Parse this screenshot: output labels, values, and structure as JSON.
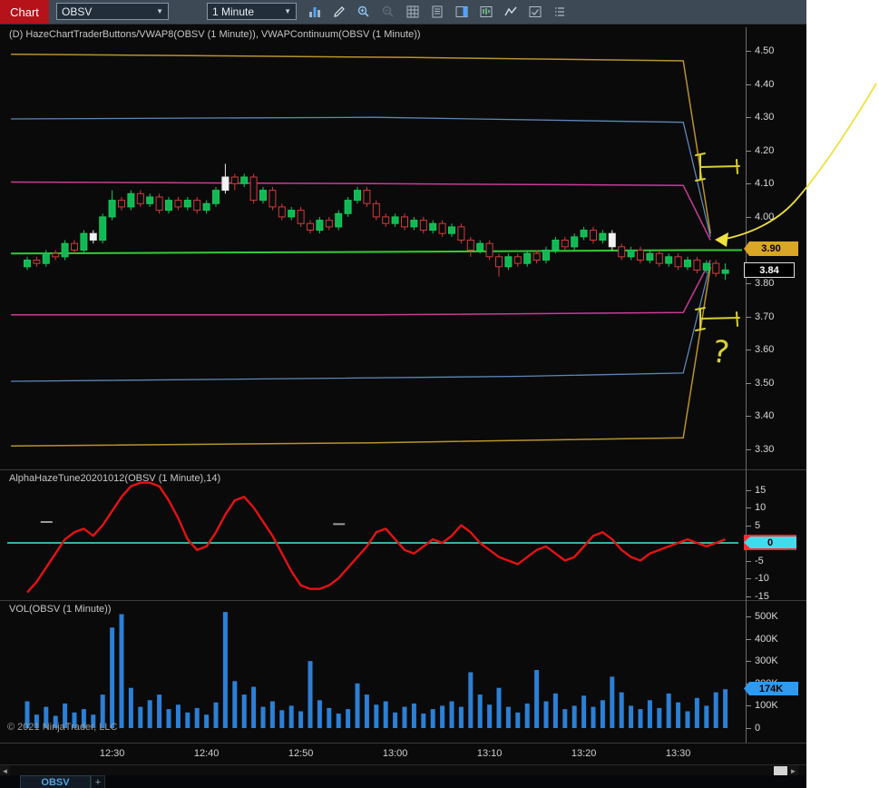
{
  "toolbar": {
    "chart_label": "Chart",
    "symbol": "OBSV",
    "interval": "1 Minute",
    "icons": [
      "chart-style",
      "drawing-tools",
      "zoom-in",
      "zoom-out",
      "grid",
      "report",
      "chart-trader",
      "data-box",
      "indicators",
      "strategies",
      "properties"
    ]
  },
  "panels": {
    "price": {
      "title": "(D) HazeChartTraderButtons/VWAP8(OBSV (1 Minute)), VWAPContinuum(OBSV (1 Minute))"
    },
    "oscillator": {
      "title": "AlphaHazeTune20201012(OBSV (1 Minute),14)"
    },
    "volume": {
      "title": "VOL(OBSV (1 Minute))"
    }
  },
  "copyright": "© 2021 NinjaTrader, LLC",
  "tabs": {
    "active": "OBSV",
    "add_label": "+"
  },
  "annotations": {
    "question_mark": "?"
  },
  "scrollbar": {
    "left_arrow": "◄",
    "right_arrow": "►"
  },
  "chart_data": [
    {
      "type": "candlestick",
      "panel": "price",
      "symbol": "OBSV",
      "interval": "1 Minute",
      "ylim": [
        3.28,
        4.52
      ],
      "y_ticks": [
        "4.50",
        "4.40",
        "4.30",
        "4.20",
        "4.10",
        "4.00",
        "3.90",
        "3.80",
        "3.70",
        "3.60",
        "3.50",
        "3.40",
        "3.30"
      ],
      "x_ticks": [
        "12:30",
        "12:40",
        "12:50",
        "13:00",
        "13:10",
        "13:20",
        "13:30"
      ],
      "price_markers": [
        {
          "label": "3.90",
          "color": "#d9a625"
        },
        {
          "label": "3.84",
          "color": "#000000"
        }
      ],
      "overlays": [
        {
          "name": "vwap-upper-3",
          "color": "#b8922c",
          "width": 1.5,
          "points": [
            [
              0.005,
              4.49
            ],
            [
              0.55,
              4.48
            ],
            [
              0.92,
              4.47
            ],
            [
              0.957,
              3.95
            ]
          ]
        },
        {
          "name": "vwap-upper-2",
          "color": "#5d87b8",
          "width": 1.3,
          "points": [
            [
              0.005,
              4.295
            ],
            [
              0.5,
              4.3
            ],
            [
              0.92,
              4.285
            ],
            [
              0.957,
              3.94
            ]
          ]
        },
        {
          "name": "vwap-upper-1",
          "color": "#c93c96",
          "width": 1.5,
          "points": [
            [
              0.005,
              4.105
            ],
            [
              0.5,
              4.1
            ],
            [
              0.92,
              4.095
            ],
            [
              0.957,
              3.93
            ]
          ]
        },
        {
          "name": "vwap",
          "color": "#33cc33",
          "width": 2.0,
          "points": [
            [
              0.005,
              3.89
            ],
            [
              0.55,
              3.895
            ],
            [
              0.93,
              3.9
            ],
            [
              1.0,
              3.9
            ]
          ]
        },
        {
          "name": "vwap-lower-1",
          "color": "#c93c96",
          "width": 1.5,
          "points": [
            [
              0.005,
              3.705
            ],
            [
              0.5,
              3.705
            ],
            [
              0.92,
              3.712
            ],
            [
              0.957,
              3.87
            ]
          ]
        },
        {
          "name": "vwap-lower-2",
          "color": "#5d87b8",
          "width": 1.3,
          "points": [
            [
              0.005,
              3.505
            ],
            [
              0.35,
              3.512
            ],
            [
              0.7,
              3.52
            ],
            [
              0.92,
              3.53
            ],
            [
              0.957,
              3.86
            ]
          ]
        },
        {
          "name": "vwap-lower-3",
          "color": "#b8922c",
          "width": 1.5,
          "points": [
            [
              0.005,
              3.31
            ],
            [
              0.5,
              3.32
            ],
            [
              0.92,
              3.335
            ],
            [
              0.957,
              3.85
            ]
          ]
        }
      ],
      "white_candles": [
        7,
        21,
        62
      ],
      "candles": [
        [
          3.85,
          3.88,
          3.84,
          3.87
        ],
        [
          3.87,
          3.88,
          3.85,
          3.86
        ],
        [
          3.86,
          3.9,
          3.85,
          3.89
        ],
        [
          3.89,
          3.9,
          3.87,
          3.88
        ],
        [
          3.88,
          3.93,
          3.87,
          3.92
        ],
        [
          3.92,
          3.93,
          3.89,
          3.9
        ],
        [
          3.9,
          3.96,
          3.89,
          3.95
        ],
        [
          3.95,
          3.96,
          3.92,
          3.93
        ],
        [
          3.93,
          4.01,
          3.92,
          4.0
        ],
        [
          4.0,
          4.08,
          3.99,
          4.05
        ],
        [
          4.05,
          4.06,
          4.02,
          4.03
        ],
        [
          4.03,
          4.08,
          4.02,
          4.07
        ],
        [
          4.07,
          4.08,
          4.03,
          4.04
        ],
        [
          4.04,
          4.07,
          4.03,
          4.06
        ],
        [
          4.06,
          4.07,
          4.01,
          4.02
        ],
        [
          4.02,
          4.06,
          4.01,
          4.05
        ],
        [
          4.05,
          4.06,
          4.02,
          4.03
        ],
        [
          4.03,
          4.06,
          4.02,
          4.05
        ],
        [
          4.05,
          4.06,
          4.01,
          4.02
        ],
        [
          4.02,
          4.05,
          4.01,
          4.04
        ],
        [
          4.04,
          4.09,
          4.03,
          4.08
        ],
        [
          4.08,
          4.16,
          4.07,
          4.12
        ],
        [
          4.12,
          4.13,
          4.08,
          4.1
        ],
        [
          4.1,
          4.13,
          4.09,
          4.12
        ],
        [
          4.12,
          4.13,
          4.04,
          4.05
        ],
        [
          4.05,
          4.09,
          4.04,
          4.08
        ],
        [
          4.08,
          4.09,
          4.02,
          4.03
        ],
        [
          4.03,
          4.04,
          3.99,
          4.0
        ],
        [
          4.0,
          4.03,
          3.99,
          4.02
        ],
        [
          4.02,
          4.03,
          3.97,
          3.98
        ],
        [
          3.98,
          3.99,
          3.95,
          3.96
        ],
        [
          3.96,
          4.0,
          3.95,
          3.99
        ],
        [
          3.99,
          4.0,
          3.96,
          3.97
        ],
        [
          3.97,
          4.02,
          3.96,
          4.01
        ],
        [
          4.01,
          4.06,
          4.0,
          4.05
        ],
        [
          4.05,
          4.09,
          4.04,
          4.08
        ],
        [
          4.08,
          4.09,
          4.03,
          4.04
        ],
        [
          4.04,
          4.05,
          3.99,
          4.0
        ],
        [
          4.0,
          4.01,
          3.97,
          3.98
        ],
        [
          3.98,
          4.01,
          3.97,
          4.0
        ],
        [
          4.0,
          4.01,
          3.96,
          3.97
        ],
        [
          3.97,
          4.0,
          3.96,
          3.99
        ],
        [
          3.99,
          4.0,
          3.95,
          3.96
        ],
        [
          3.96,
          3.99,
          3.95,
          3.98
        ],
        [
          3.98,
          3.99,
          3.94,
          3.95
        ],
        [
          3.95,
          3.98,
          3.94,
          3.97
        ],
        [
          3.97,
          3.98,
          3.92,
          3.93
        ],
        [
          3.93,
          3.94,
          3.88,
          3.9
        ],
        [
          3.9,
          3.93,
          3.89,
          3.92
        ],
        [
          3.92,
          3.93,
          3.87,
          3.88
        ],
        [
          3.88,
          3.89,
          3.82,
          3.85
        ],
        [
          3.85,
          3.89,
          3.84,
          3.88
        ],
        [
          3.88,
          3.89,
          3.85,
          3.86
        ],
        [
          3.86,
          3.9,
          3.85,
          3.89
        ],
        [
          3.89,
          3.9,
          3.86,
          3.87
        ],
        [
          3.87,
          3.91,
          3.86,
          3.9
        ],
        [
          3.9,
          3.94,
          3.89,
          3.93
        ],
        [
          3.93,
          3.94,
          3.9,
          3.91
        ],
        [
          3.91,
          3.95,
          3.9,
          3.94
        ],
        [
          3.94,
          3.97,
          3.93,
          3.96
        ],
        [
          3.96,
          3.97,
          3.92,
          3.93
        ],
        [
          3.93,
          3.96,
          3.92,
          3.95
        ],
        [
          3.95,
          3.96,
          3.9,
          3.91
        ],
        [
          3.91,
          3.92,
          3.87,
          3.88
        ],
        [
          3.88,
          3.91,
          3.87,
          3.9
        ],
        [
          3.9,
          3.91,
          3.86,
          3.87
        ],
        [
          3.87,
          3.9,
          3.86,
          3.89
        ],
        [
          3.89,
          3.9,
          3.85,
          3.86
        ],
        [
          3.86,
          3.89,
          3.85,
          3.88
        ],
        [
          3.88,
          3.89,
          3.84,
          3.85
        ],
        [
          3.85,
          3.88,
          3.84,
          3.87
        ],
        [
          3.87,
          3.88,
          3.83,
          3.84
        ],
        [
          3.84,
          3.87,
          3.83,
          3.86
        ],
        [
          3.86,
          3.87,
          3.82,
          3.83
        ],
        [
          3.83,
          3.86,
          3.81,
          3.84
        ]
      ]
    },
    {
      "type": "line",
      "panel": "oscillator",
      "name": "AlphaHazeTune20201012",
      "ylim": [
        -17,
        17
      ],
      "y_ticks": [
        "15",
        "10",
        "5",
        "0",
        "-5",
        "-10",
        "-15"
      ],
      "zero_line": 0,
      "marker": {
        "label": "0"
      },
      "dash_markers": [
        {
          "bar": 2,
          "value": 5.9
        },
        {
          "bar": 33,
          "value": 5.3
        }
      ],
      "values": [
        -14,
        -11,
        -7,
        -3,
        1,
        3,
        4,
        2,
        5,
        9,
        13,
        16,
        17,
        17,
        16,
        12,
        7,
        1,
        -2,
        -1,
        3,
        8,
        12,
        13,
        10,
        6,
        2,
        -3,
        -8,
        -12,
        -13,
        -13,
        -12,
        -10,
        -7,
        -4,
        -1,
        3,
        4,
        1,
        -2,
        -3,
        -1,
        1,
        0,
        2,
        5,
        3,
        0,
        -2,
        -4,
        -5,
        -6,
        -4,
        -2,
        -1,
        -3,
        -5,
        -4,
        -1,
        2,
        3,
        1,
        -2,
        -4,
        -5,
        -3,
        -2,
        -1,
        0,
        1,
        0,
        -1,
        0,
        1
      ]
    },
    {
      "type": "bar",
      "panel": "volume",
      "name": "VOL",
      "ylim": [
        0,
        520
      ],
      "y_ticks": [
        {
          "label": "500K",
          "value": 500
        },
        {
          "label": "400K",
          "value": 400
        },
        {
          "label": "300K",
          "value": 300
        },
        {
          "label": "200K",
          "value": 200
        },
        {
          "label": "100K",
          "value": 100
        },
        {
          "label": "0",
          "value": 0
        }
      ],
      "marker": {
        "label": "174K",
        "value": 174
      },
      "values_thousands": [
        120,
        60,
        95,
        55,
        110,
        70,
        85,
        60,
        150,
        450,
        510,
        180,
        95,
        125,
        150,
        85,
        105,
        70,
        90,
        60,
        115,
        520,
        210,
        150,
        185,
        95,
        120,
        80,
        100,
        75,
        300,
        125,
        90,
        65,
        85,
        200,
        150,
        105,
        120,
        70,
        95,
        110,
        65,
        85,
        100,
        120,
        95,
        250,
        150,
        105,
        180,
        95,
        70,
        110,
        260,
        120,
        155,
        85,
        100,
        145,
        95,
        125,
        230,
        160,
        100,
        85,
        125,
        90,
        155,
        115,
        75,
        135,
        100,
        160,
        174
      ]
    }
  ]
}
